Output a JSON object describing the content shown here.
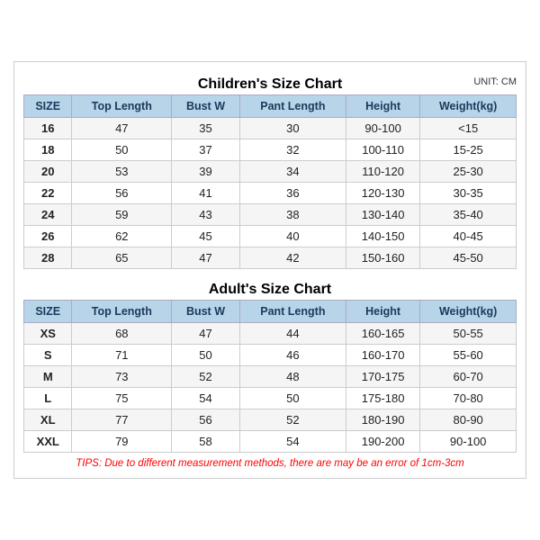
{
  "children_section": {
    "title": "Children's Size Chart",
    "unit": "UNIT: CM",
    "headers": [
      "SIZE",
      "Top Length",
      "Bust W",
      "Pant Length",
      "Height",
      "Weight(kg)"
    ],
    "rows": [
      [
        "16",
        "47",
        "35",
        "30",
        "90-100",
        "<15"
      ],
      [
        "18",
        "50",
        "37",
        "32",
        "100-110",
        "15-25"
      ],
      [
        "20",
        "53",
        "39",
        "34",
        "110-120",
        "25-30"
      ],
      [
        "22",
        "56",
        "41",
        "36",
        "120-130",
        "30-35"
      ],
      [
        "24",
        "59",
        "43",
        "38",
        "130-140",
        "35-40"
      ],
      [
        "26",
        "62",
        "45",
        "40",
        "140-150",
        "40-45"
      ],
      [
        "28",
        "65",
        "47",
        "42",
        "150-160",
        "45-50"
      ]
    ]
  },
  "adult_section": {
    "title": "Adult's Size Chart",
    "headers": [
      "SIZE",
      "Top Length",
      "Bust W",
      "Pant Length",
      "Height",
      "Weight(kg)"
    ],
    "rows": [
      [
        "XS",
        "68",
        "47",
        "44",
        "160-165",
        "50-55"
      ],
      [
        "S",
        "71",
        "50",
        "46",
        "160-170",
        "55-60"
      ],
      [
        "M",
        "73",
        "52",
        "48",
        "170-175",
        "60-70"
      ],
      [
        "L",
        "75",
        "54",
        "50",
        "175-180",
        "70-80"
      ],
      [
        "XL",
        "77",
        "56",
        "52",
        "180-190",
        "80-90"
      ],
      [
        "XXL",
        "79",
        "58",
        "54",
        "190-200",
        "90-100"
      ]
    ]
  },
  "tips": "TIPS: Due to different measurement methods, there are may be an error of 1cm-3cm"
}
